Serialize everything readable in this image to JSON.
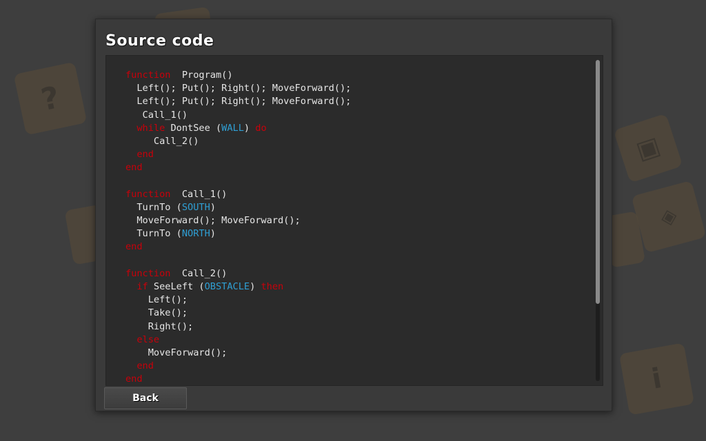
{
  "dialog": {
    "title": "Source code",
    "back_label": "Back"
  },
  "background": {
    "tiles": [
      {
        "icon": "question-mark-icon",
        "glyph": "?"
      },
      {
        "icon": "frame-icon",
        "glyph": "▣"
      },
      {
        "icon": "compass-icon",
        "glyph": "◈"
      },
      {
        "icon": "info-down-icon",
        "glyph": "i"
      }
    ]
  },
  "colors": {
    "keyword": "#c8000a",
    "constant": "#2f9fd4",
    "text": "#e6e6e6"
  },
  "code_lines": [
    [
      {
        "t": "function",
        "c": "kw"
      },
      {
        "t": "  Program()"
      }
    ],
    [
      {
        "t": "  Left(); Put(); Right(); MoveForward();"
      }
    ],
    [
      {
        "t": "  Left(); Put(); Right(); MoveForward();"
      }
    ],
    [
      {
        "t": "   Call_1()"
      }
    ],
    [
      {
        "t": "  "
      },
      {
        "t": "while",
        "c": "kw"
      },
      {
        "t": " DontSee ("
      },
      {
        "t": "WALL",
        "c": "const"
      },
      {
        "t": ") "
      },
      {
        "t": "do",
        "c": "kw"
      }
    ],
    [
      {
        "t": "     Call_2()"
      }
    ],
    [
      {
        "t": "  "
      },
      {
        "t": "end",
        "c": "kw"
      }
    ],
    [
      {
        "t": "end",
        "c": "kw"
      }
    ],
    [
      {
        "t": ""
      }
    ],
    [
      {
        "t": "function",
        "c": "kw"
      },
      {
        "t": "  Call_1()"
      }
    ],
    [
      {
        "t": "  TurnTo ("
      },
      {
        "t": "SOUTH",
        "c": "const"
      },
      {
        "t": ")"
      }
    ],
    [
      {
        "t": "  MoveForward(); MoveForward();"
      }
    ],
    [
      {
        "t": "  TurnTo ("
      },
      {
        "t": "NORTH",
        "c": "const"
      },
      {
        "t": ")"
      }
    ],
    [
      {
        "t": "end",
        "c": "kw"
      }
    ],
    [
      {
        "t": ""
      }
    ],
    [
      {
        "t": "function",
        "c": "kw"
      },
      {
        "t": "  Call_2()"
      }
    ],
    [
      {
        "t": "  "
      },
      {
        "t": "if",
        "c": "kw"
      },
      {
        "t": " SeeLeft ("
      },
      {
        "t": "OBSTACLE",
        "c": "const"
      },
      {
        "t": ") "
      },
      {
        "t": "then",
        "c": "kw"
      }
    ],
    [
      {
        "t": "    Left();"
      }
    ],
    [
      {
        "t": "    Take();"
      }
    ],
    [
      {
        "t": "    Right();"
      }
    ],
    [
      {
        "t": "  "
      },
      {
        "t": "else",
        "c": "kw"
      }
    ],
    [
      {
        "t": "    MoveForward();"
      }
    ],
    [
      {
        "t": "  "
      },
      {
        "t": "end",
        "c": "kw"
      }
    ],
    [
      {
        "t": "end",
        "c": "kw"
      }
    ]
  ],
  "scroll": {
    "visible_fraction": 0.76,
    "position": 0.0
  }
}
